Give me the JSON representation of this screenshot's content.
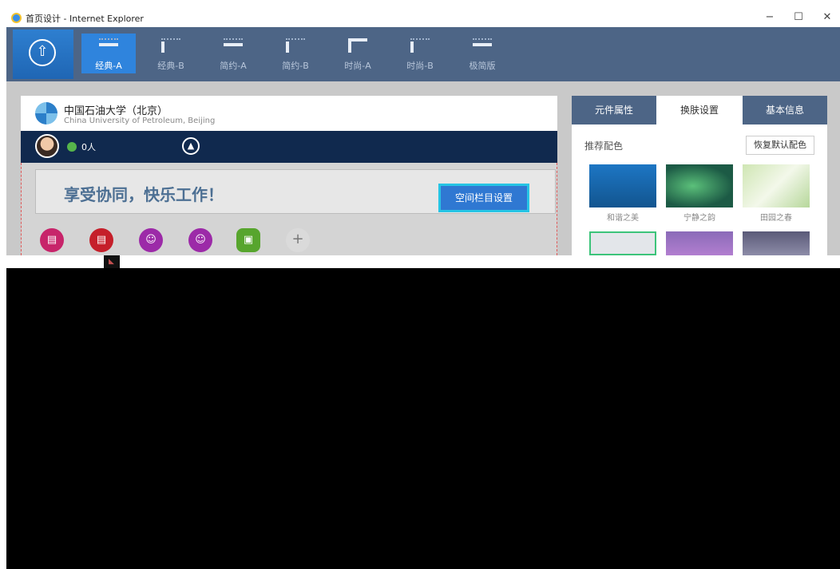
{
  "window": {
    "title": "首页设计 - Internet Explorer",
    "controls": {
      "minimize": "−",
      "maximize": "☐",
      "close": "✕"
    }
  },
  "toolbar": {
    "home_icon": "⇧",
    "templates": [
      {
        "label": "经典-A",
        "active": true
      },
      {
        "label": "经典-B",
        "active": false
      },
      {
        "label": "简约-A",
        "active": false
      },
      {
        "label": "简约-B",
        "active": false
      },
      {
        "label": "时尚-A",
        "active": false
      },
      {
        "label": "时尚-B",
        "active": false
      },
      {
        "label": "极简版",
        "active": false
      }
    ]
  },
  "preview": {
    "university_name": "中国石油大学（北京）",
    "university_en": "China University of Petroleum, Beijing",
    "online_count": "0人",
    "nav_icon": "▲",
    "banner_text": "享受协同，快乐工作！",
    "column_settings_button": "空间栏目设置",
    "apps": [
      {
        "icon": "doc-icon",
        "color": "#c7246a"
      },
      {
        "icon": "doc-icon",
        "color": "#c51f2a"
      },
      {
        "icon": "users-icon",
        "color": "#9c2aa8"
      },
      {
        "icon": "users-icon",
        "color": "#9c2aa8"
      },
      {
        "icon": "contact-icon",
        "color": "#57a52d"
      }
    ],
    "add_icon": "+"
  },
  "side_panel": {
    "tabs": [
      {
        "label": "元件属性",
        "active": false
      },
      {
        "label": "换肤设置",
        "active": true
      },
      {
        "label": "基本信息",
        "active": false
      }
    ],
    "recommended_label": "推荐配色",
    "reset_button": "恢复默认配色",
    "swatches": [
      {
        "label": "和谐之美",
        "selected": false
      },
      {
        "label": "宁静之韵",
        "selected": false
      },
      {
        "label": "田园之春",
        "selected": false
      },
      {
        "label": "",
        "selected": true
      },
      {
        "label": "",
        "selected": false
      },
      {
        "label": "",
        "selected": false
      }
    ]
  }
}
